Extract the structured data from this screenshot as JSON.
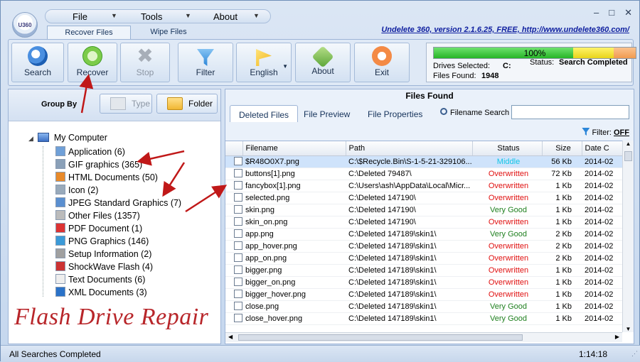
{
  "app": {
    "logo_text": "U360",
    "version_link": "Undelete 360, version 2.1.6.25, FREE, http://www.undelete360.com/"
  },
  "menu": [
    {
      "label": "File"
    },
    {
      "label": "Tools"
    },
    {
      "label": "About"
    }
  ],
  "window_controls": {
    "minimize": "–",
    "maximize": "□",
    "close": "✕"
  },
  "ribbon_tabs": [
    {
      "label": "Recover Files",
      "active": true
    },
    {
      "label": "Wipe Files",
      "active": false
    }
  ],
  "toolbar": {
    "search": "Search",
    "recover": "Recover",
    "stop": "Stop",
    "filter": "Filter",
    "english": "English",
    "about": "About",
    "exit": "Exit"
  },
  "status": {
    "progress_text": "100%",
    "progress_value": 1.0,
    "drives_label": "Drives Selected:",
    "drives_value": "C:",
    "files_found_label": "Files Found:",
    "files_found_value": "1948",
    "status_label": "Status:",
    "status_value": "Search Completed"
  },
  "group_by": {
    "label": "Group By",
    "type_btn": "Type",
    "folder_btn": "Folder"
  },
  "tree": {
    "root": "My Computer",
    "items": [
      "Application (6)",
      "GIF graphics (365)",
      "HTML Documents (50)",
      "Icon (2)",
      "JPEG Standard Graphics (7)",
      "Other Files (1357)",
      "PDF Document (1)",
      "PNG Graphics (146)",
      "Setup Information (2)",
      "ShockWave Flash (4)",
      "Text Documents (6)",
      "XML Documents (3)"
    ]
  },
  "watermark": "Flash Drive Repair",
  "files_panel": {
    "title": "Files Found",
    "tabs": [
      "Deleted Files",
      "File Preview",
      "File Properties"
    ],
    "search_label": "Filename Search",
    "filter_label": "Filter:",
    "filter_value": "OFF",
    "columns": [
      "Filename",
      "Path",
      "Status",
      "Size",
      "Date C"
    ],
    "rows": [
      [
        "$R48O0X7.png",
        "C:\\$Recycle.Bin\\S-1-5-21-329106...",
        "Middle",
        "56 Kb",
        "2014-02"
      ],
      [
        "buttons[1].png",
        "C:\\Deleted 79487\\",
        "Overwritten",
        "72 Kb",
        "2014-02"
      ],
      [
        "fancybox[1].png",
        "C:\\Users\\ash\\AppData\\Local\\Micr...",
        "Overwritten",
        "1 Kb",
        "2014-02"
      ],
      [
        "selected.png",
        "C:\\Deleted 147190\\",
        "Overwritten",
        "1 Kb",
        "2014-02"
      ],
      [
        "skin.png",
        "C:\\Deleted 147190\\",
        "Very Good",
        "1 Kb",
        "2014-02"
      ],
      [
        "skin_on.png",
        "C:\\Deleted 147190\\",
        "Overwritten",
        "1 Kb",
        "2014-02"
      ],
      [
        "app.png",
        "C:\\Deleted 147189\\skin1\\",
        "Very Good",
        "2 Kb",
        "2014-02"
      ],
      [
        "app_hover.png",
        "C:\\Deleted 147189\\skin1\\",
        "Overwritten",
        "2 Kb",
        "2014-02"
      ],
      [
        "app_on.png",
        "C:\\Deleted 147189\\skin1\\",
        "Overwritten",
        "2 Kb",
        "2014-02"
      ],
      [
        "bigger.png",
        "C:\\Deleted 147189\\skin1\\",
        "Overwritten",
        "1 Kb",
        "2014-02"
      ],
      [
        "bigger_on.png",
        "C:\\Deleted 147189\\skin1\\",
        "Overwritten",
        "1 Kb",
        "2014-02"
      ],
      [
        "bigger_hover.png",
        "C:\\Deleted 147189\\skin1\\",
        "Overwritten",
        "1 Kb",
        "2014-02"
      ],
      [
        "close.png",
        "C:\\Deleted 147189\\skin1\\",
        "Very Good",
        "1 Kb",
        "2014-02"
      ],
      [
        "close_hover.png",
        "C:\\Deleted 147189\\skin1\\",
        "Very Good",
        "1 Kb",
        "2014-02"
      ]
    ]
  },
  "statusbar": {
    "left": "All Searches Completed",
    "time": "1:14:18"
  },
  "colors": {
    "overwritten": "#e01010",
    "very_good": "#208020",
    "middle": "#12c6e6",
    "annotation_arrow": "#c01818"
  }
}
